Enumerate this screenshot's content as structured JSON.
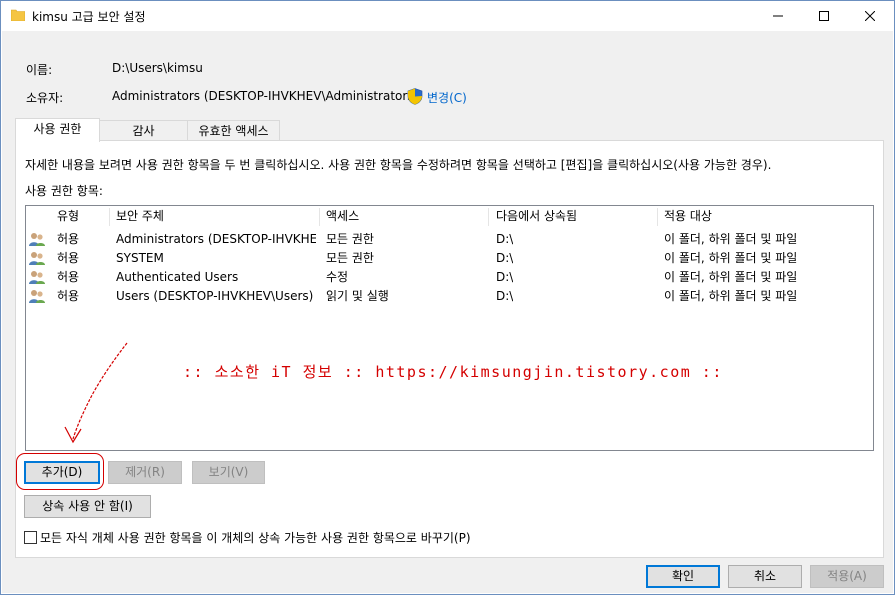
{
  "window": {
    "title": "kimsu 고급 보안 설정",
    "minimize": "—",
    "maximize": "☐",
    "close": "✕"
  },
  "info": {
    "name_label": "이름:",
    "name_value": "D:\\Users\\kimsu",
    "owner_label": "소유자:",
    "owner_value": "Administrators (DESKTOP-IHVKHEV\\Administrators)",
    "change_link": "변경(C)"
  },
  "tabs": [
    {
      "label": "사용 권한",
      "active": true
    },
    {
      "label": "감사",
      "active": false
    },
    {
      "label": "유효한 액세스",
      "active": false
    }
  ],
  "permissions": {
    "description": "자세한 내용을 보려면 사용 권한 항목을 두 번 클릭하십시오. 사용 권한 항목을 수정하려면 항목을 선택하고 [편집]을 클릭하십시오(사용 가능한 경우).",
    "list_label": "사용 권한 항목:",
    "columns": [
      "유형",
      "보안 주체",
      "액세스",
      "다음에서 상속됨",
      "적용 대상"
    ],
    "rows": [
      {
        "type": "허용",
        "principal": "Administrators (DESKTOP-IHVKHE...",
        "access": "모든 권한",
        "inherited": "D:\\",
        "applies": "이 폴더, 하위 폴더 및 파일"
      },
      {
        "type": "허용",
        "principal": "SYSTEM",
        "access": "모든 권한",
        "inherited": "D:\\",
        "applies": "이 폴더, 하위 폴더 및 파일"
      },
      {
        "type": "허용",
        "principal": "Authenticated Users",
        "access": "수정",
        "inherited": "D:\\",
        "applies": "이 폴더, 하위 폴더 및 파일"
      },
      {
        "type": "허용",
        "principal": "Users (DESKTOP-IHVKHEV\\Users)",
        "access": "읽기 및 실행",
        "inherited": "D:\\",
        "applies": "이 폴더, 하위 폴더 및 파일"
      }
    ],
    "add_button": "추가(D)",
    "remove_button": "제거(R)",
    "view_button": "보기(V)",
    "disable_inheritance_button": "상속 사용 안 함(I)",
    "replace_checkbox_label": "모든 자식 개체 사용 권한 항목을 이 개체의 상속 가능한 사용 권한 항목으로 바꾸기(P)",
    "replace_checked": false
  },
  "watermark": ":: 소소한 iT 정보 :: https://kimsungjin.tistory.com ::",
  "footer": {
    "ok": "확인",
    "cancel": "취소",
    "apply": "적용(A)"
  },
  "colors": {
    "link": "#0066cc",
    "annotation": "#d40000",
    "focus": "#0078d7"
  }
}
